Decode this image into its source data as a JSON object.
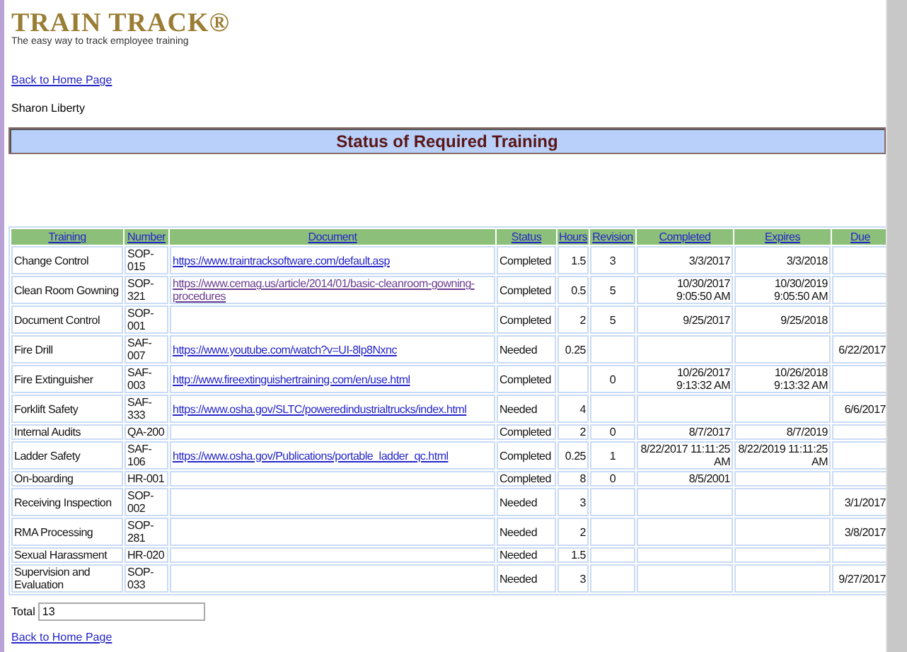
{
  "logo": {
    "name": "TRAIN TRACK®",
    "tagline": "The easy way to track employee training"
  },
  "top_link": "Back to Home Page",
  "user": "Sharon Liberty",
  "title": "Status of Required Training",
  "table": {
    "columns": [
      "Training",
      "Number",
      "Document",
      "Status",
      "Hours",
      "Revision",
      "Completed",
      "Expires",
      "Due"
    ],
    "rows": [
      {
        "training": "Change Control",
        "number": "SOP-015",
        "document": {
          "url": "https://www.traintracksoftware.com/default.asp",
          "visited": false
        },
        "status": "Completed",
        "hours": "1.5",
        "revision": "3",
        "completed": "3/3/2017",
        "expires": "3/3/2018",
        "due": ""
      },
      {
        "training": "Clean Room Gowning",
        "number": "SOP-321",
        "document": {
          "url": "https://www.cemag.us/article/2014/01/basic-cleanroom-gowning-procedures",
          "visited": true
        },
        "status": "Completed",
        "hours": "0.5",
        "revision": "5",
        "completed": "10/30/2017 9:05:50 AM",
        "expires": "10/30/2019 9:05:50 AM",
        "due": ""
      },
      {
        "training": "Document Control",
        "number": "SOP-001",
        "status": "Completed",
        "hours": "2",
        "revision": "5",
        "completed": "9/25/2017",
        "expires": "9/25/2018",
        "due": ""
      },
      {
        "training": "Fire Drill",
        "number": "SAF-007",
        "document": {
          "url": "https://www.youtube.com/watch?v=UI-8lp8Nxnc",
          "visited": false
        },
        "status": "Needed",
        "hours": "0.25",
        "revision": "",
        "completed": "",
        "expires": "",
        "due": "6/22/2017"
      },
      {
        "training": "Fire Extinguisher",
        "number": "SAF-003",
        "document": {
          "url": "http://www.fireextinguishertraining.com/en/use.html",
          "visited": false
        },
        "status": "Completed",
        "hours": "",
        "revision": "0",
        "completed": "10/26/2017 9:13:32 AM",
        "expires": "10/26/2018 9:13:32 AM",
        "due": ""
      },
      {
        "training": "Forklift Safety",
        "number": "SAF-333",
        "document": {
          "url": "https://www.osha.gov/SLTC/poweredindustrialtrucks/index.html",
          "visited": false
        },
        "status": "Needed",
        "hours": "4",
        "revision": "",
        "completed": "",
        "expires": "",
        "due": "6/6/2017"
      },
      {
        "training": "Internal Audits",
        "number": "QA-200",
        "status": "Completed",
        "hours": "2",
        "revision": "0",
        "completed": "8/7/2017",
        "expires": "8/7/2019",
        "due": ""
      },
      {
        "training": "Ladder Safety",
        "number": "SAF-106",
        "document": {
          "url": "https://www.osha.gov/Publications/portable_ladder_qc.html",
          "visited": false
        },
        "status": "Completed",
        "hours": "0.25",
        "revision": "1",
        "completed": "8/22/2017 11:11:25 AM",
        "expires": "8/22/2019 11:11:25 AM",
        "due": ""
      },
      {
        "training": "On-boarding",
        "number": "HR-001",
        "status": "Completed",
        "hours": "8",
        "revision": "0",
        "completed": "8/5/2001",
        "expires": "",
        "due": ""
      },
      {
        "training": "Receiving Inspection",
        "number": "SOP-002",
        "status": "Needed",
        "hours": "3",
        "revision": "",
        "completed": "",
        "expires": "",
        "due": "3/1/2017"
      },
      {
        "training": "RMA Processing",
        "number": "SOP-281",
        "status": "Needed",
        "hours": "2",
        "revision": "",
        "completed": "",
        "expires": "",
        "due": "3/8/2017"
      },
      {
        "training": "Sexual Harassment",
        "number": "HR-020",
        "status": "Needed",
        "hours": "1.5",
        "revision": "",
        "completed": "",
        "expires": "",
        "due": ""
      },
      {
        "training": "Supervision and Evaluation",
        "number": "SOP-033",
        "status": "Needed",
        "hours": "3",
        "revision": "",
        "completed": "",
        "expires": "",
        "due": "9/27/2017"
      }
    ]
  },
  "total": {
    "label": "Total",
    "value": "13"
  },
  "bottom_link": "Back to Home Page"
}
